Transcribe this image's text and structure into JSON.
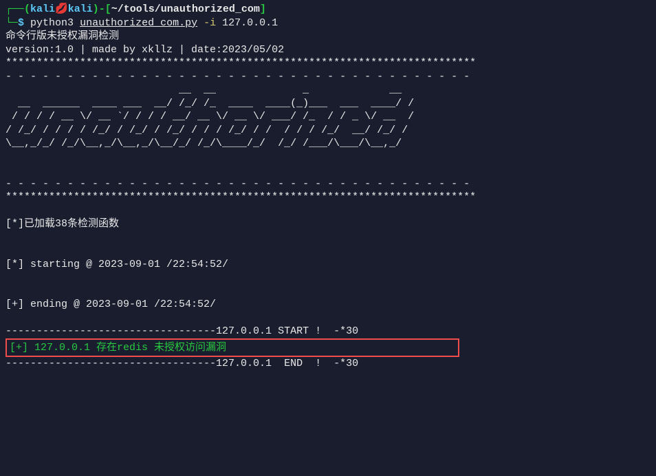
{
  "prompt": {
    "tree_char": "┌──",
    "open_paren": "(",
    "user": "kali",
    "heart": "💋",
    "host": "kali",
    "close_paren": ")",
    "sep": "-",
    "bracket_open": "[",
    "path": "~/tools/unauthorized_com",
    "bracket_close": "]",
    "line2_prefix": "└─",
    "dollar": "$",
    "cmd_interpreter": "python3",
    "cmd_script": "unauthorized_com.py",
    "cmd_flag": "-i",
    "cmd_arg": "127.0.0.1"
  },
  "header": {
    "title": "命令行版未授权漏洞检测",
    "version_line": "version:1.0 | made by xkllz | date:2023/05/02",
    "stars": "****************************************************************************",
    "dashes": "- - - - - - - - - - - - - - - - - - - - - - - - - - - - - - - - - - - - - - "
  },
  "ascii_art": [
    "                            __  __              _             __",
    "  __  ______  ____ ___  __/ /_/ /_  ____  ____(_)___  ___  ____/ /",
    " / / / / __ \\/ __ `/ / / / __/ __ \\/ __ \\/ ___/ /_  / / _ \\/ __  /",
    "/ /_/ / / / / /_/ / /_/ / /_/ / / / /_/ / /  / / / /_/  __/ /_/ /",
    "\\__,_/_/ /_/\\__,_/\\__,_/\\__/_/ /_/\\____/_/  /_/ /___/\\___/\\__,_/"
  ],
  "status": {
    "loaded": "[*]已加载38条检测函数",
    "starting": "[*] starting @ 2023-09-01 /22:54:52/",
    "ending": "[+] ending @ 2023-09-01 /22:54:52/",
    "start_marker": "----------------------------------127.0.0.1 START !  -*30",
    "result": "[+] 127.0.0.1 存在redis 未授权访问漏洞",
    "end_marker": "----------------------------------127.0.0.1  END  !  -*30"
  }
}
